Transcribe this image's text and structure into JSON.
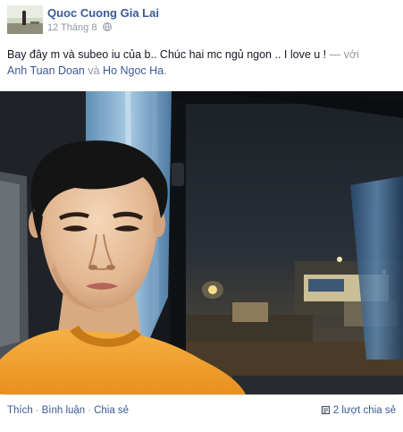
{
  "post": {
    "author": "Quoc Cuong Gia Lai",
    "timestamp": "12 Tháng 8",
    "privacy_icon": "globe-icon",
    "status_text": "Bay đây m và subeo iu của b.. Chúc hai mc ngủ ngon .. I love u !",
    "with_prefix": "— với",
    "tagged": [
      "Anh Tuan Doan",
      "Ho Ngoc Ha"
    ],
    "tag_joiner": "và",
    "tag_suffix": ".",
    "photo_icon": "selfie-photo"
  },
  "footer": {
    "like_label": "Thích",
    "comment_label": "Bình luận",
    "share_label": "Chia sẻ",
    "separator": "·",
    "share_count_label": "2 lượt chia sẻ",
    "share_count_icon": "share-count-icon"
  },
  "colors": {
    "link": "#3b5998",
    "muted": "#9197a3",
    "text": "#141823"
  }
}
